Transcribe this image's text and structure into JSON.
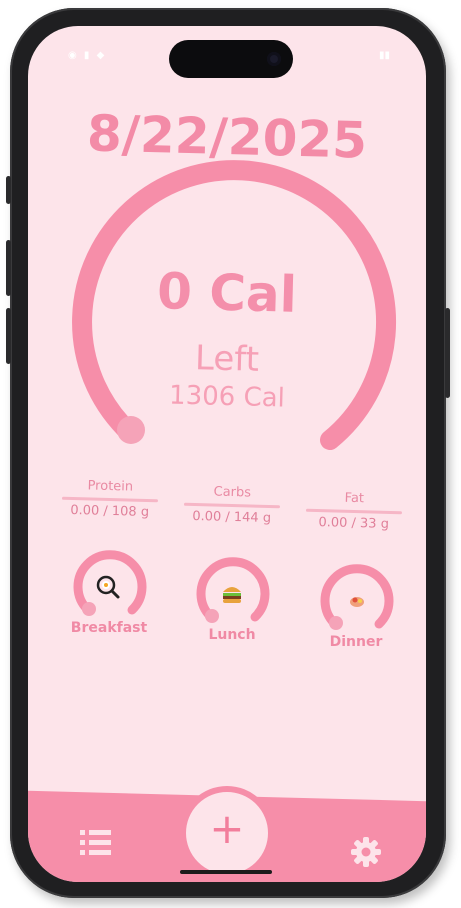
{
  "date": "8/22/2025",
  "calories": {
    "consumed_label": "0 Cal",
    "left_label": "Left",
    "total_label": "1306 Cal",
    "progress": 0
  },
  "macros": [
    {
      "name": "Protein",
      "value": "0.00 / 108 g",
      "progress": 0
    },
    {
      "name": "Carbs",
      "value": "0.00 / 144 g",
      "progress": 0
    },
    {
      "name": "Fat",
      "value": "0.00 / 33 g",
      "progress": 0
    }
  ],
  "meals": [
    {
      "name": "Breakfast",
      "icon": "frying-pan-egg-icon",
      "progress": 0
    },
    {
      "name": "Lunch",
      "icon": "burger-icon",
      "progress": 0
    },
    {
      "name": "Dinner",
      "icon": "dinner-plate-icon",
      "progress": 0
    }
  ],
  "nav": {
    "left_icon": "list-icon",
    "center_icon": "add-icon",
    "center_label": "+",
    "right_icon": "gear-icon"
  },
  "colors": {
    "background": "#fde4ea",
    "accent": "#f68ea9",
    "text_accent": "#f48fab",
    "phone_frame": "#1f1f21"
  }
}
